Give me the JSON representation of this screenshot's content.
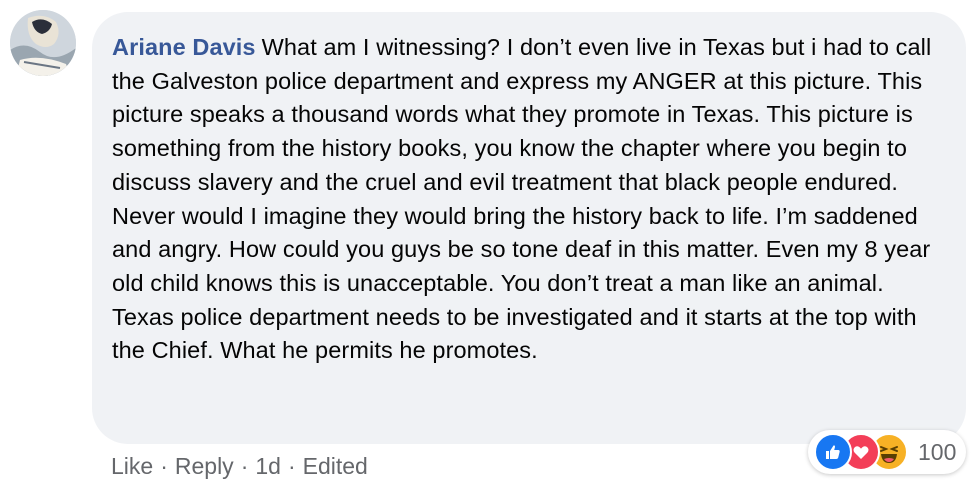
{
  "comment": {
    "author": "Ariane Davis",
    "text": "What am I witnessing? I don’t even live in Texas but i had to call the Galveston police department and express my ANGER at this picture. This picture speaks a thousand words what they promote in Texas. This picture is something from the history books, you know the chapter where you begin to discuss slavery and the cruel and evil treatment that black people endured. Never would I imagine they would bring the history back to life. I’m saddened and angry. How could you guys be so tone deaf in this matter. Even my 8 year old child knows this is unacceptable. You don’t treat a man like an animal. Texas police department needs to be investigated and it starts at the top with the Chief. What he permits he promotes."
  },
  "reactions": {
    "icons": [
      "like-icon",
      "love-icon",
      "haha-icon"
    ],
    "count": "100",
    "colors": {
      "like": "#1877f2",
      "love": "#f33e58",
      "haha": "#f7b125"
    }
  },
  "actions": {
    "like_label": "Like",
    "reply_label": "Reply",
    "separator": "·",
    "time": "1d",
    "edited_label": "Edited"
  },
  "colors": {
    "author": "#385898",
    "bubble_bg": "#f0f2f5",
    "meta_text": "#65676b"
  }
}
